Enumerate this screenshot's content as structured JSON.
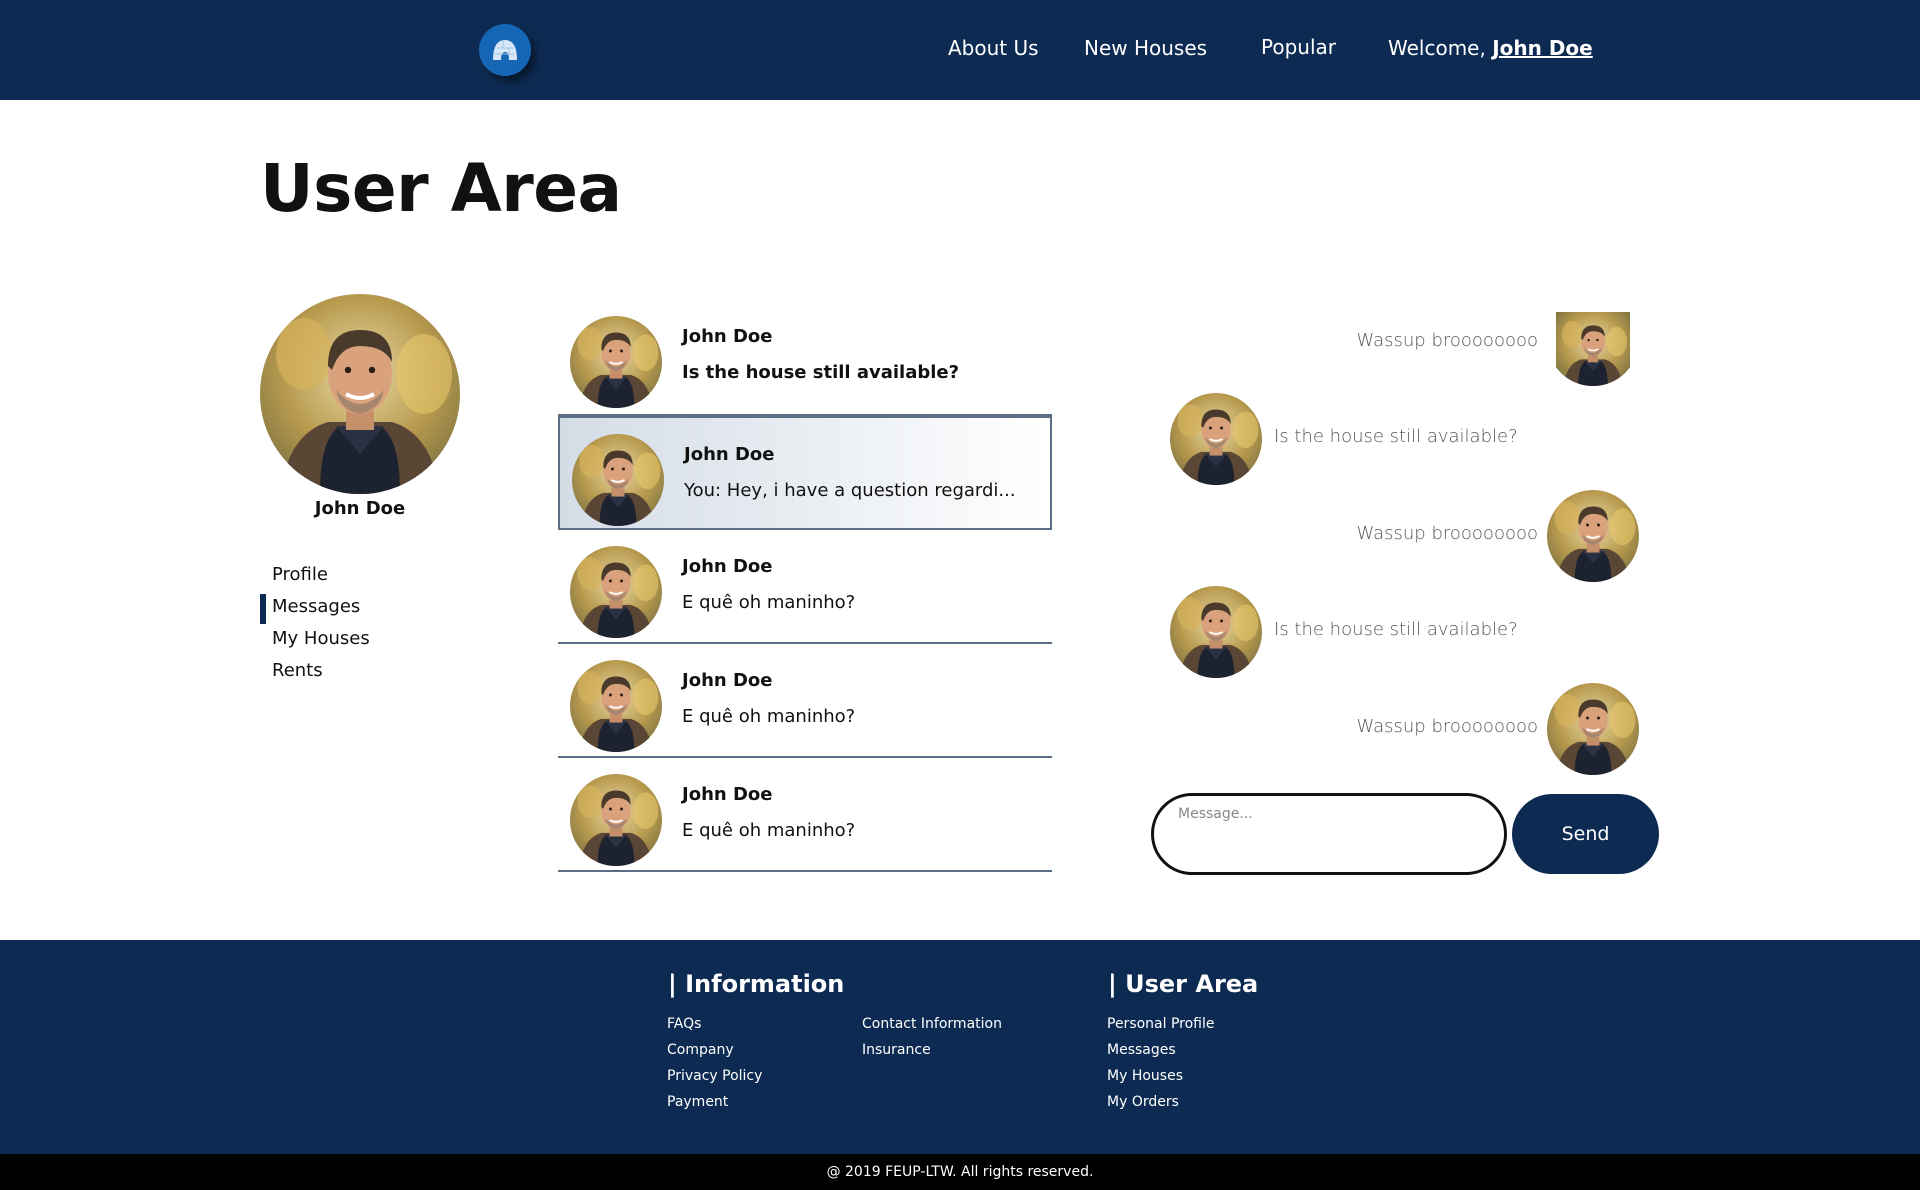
{
  "header": {
    "logo_icon": "igloo-icon",
    "nav": [
      {
        "label": "About Us"
      },
      {
        "label": "New Houses"
      },
      {
        "label": "Popular"
      }
    ],
    "welcome_prefix": "Welcome, ",
    "welcome_name": "John Doe",
    "bg_color": "#0d2b52"
  },
  "page": {
    "title": "User Area"
  },
  "profile": {
    "name": "John Doe",
    "avatar_icon": "user-avatar"
  },
  "side_menu": {
    "items": [
      {
        "label": "Profile"
      },
      {
        "label": "Messages",
        "active": true
      },
      {
        "label": "My Houses"
      },
      {
        "label": "Rents"
      }
    ]
  },
  "conversations": [
    {
      "name": "John Doe",
      "preview": "Is the house still available?",
      "unread": true
    },
    {
      "name": "John Doe",
      "preview": "You: Hey, i have a question regardi...",
      "selected": true
    },
    {
      "name": "John Doe",
      "preview": "E quê oh maninho?"
    },
    {
      "name": "John Doe",
      "preview": "E quê oh maninho?"
    },
    {
      "name": "John Doe",
      "preview": "E quê oh maninho?"
    }
  ],
  "chat": {
    "messages": [
      {
        "text": "Wassup broooooooo",
        "side": "right"
      },
      {
        "text": "Is the house still available?",
        "side": "left"
      },
      {
        "text": "Wassup broooooooo",
        "side": "right"
      },
      {
        "text": "Is the house still available?",
        "side": "left"
      },
      {
        "text": "Wassup broooooooo",
        "side": "right"
      }
    ],
    "input_placeholder": "Message...",
    "send_label": "Send"
  },
  "footer": {
    "information": {
      "heading": "| Information",
      "col1": [
        "FAQs",
        "Company",
        "Privacy Policy",
        "Payment"
      ],
      "col2": [
        "Contact Information",
        "Insurance"
      ]
    },
    "user_area": {
      "heading": "| User Area",
      "links": [
        "Personal Profile",
        "Messages",
        "My Houses",
        "My Orders"
      ]
    },
    "copyright": "@ 2019 FEUP-LTW. All rights reserved."
  }
}
